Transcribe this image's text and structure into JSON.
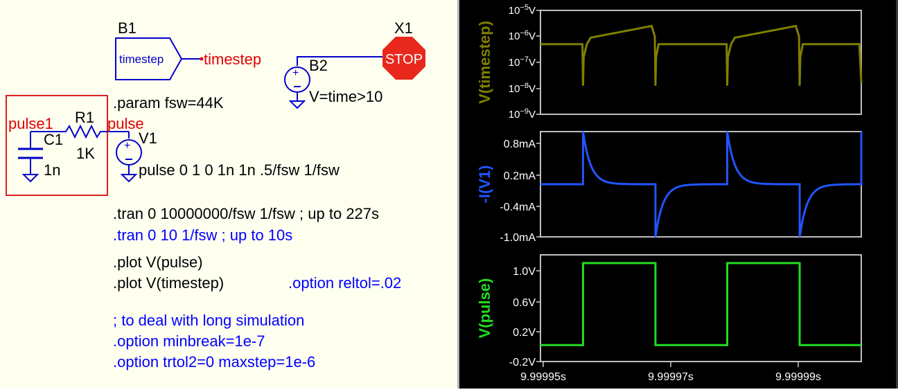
{
  "schematic": {
    "b1": {
      "label": "B1",
      "box_text": "timestep",
      "net": "timestep"
    },
    "x1": {
      "label": "X1",
      "stop": "STOP"
    },
    "b2": {
      "label": "B2",
      "expr": "V=time>10"
    },
    "param": ".param fsw=44K",
    "nets": {
      "left": "pulse1",
      "right": "pulse"
    },
    "r1": {
      "label": "R1",
      "value": "1K"
    },
    "c1": {
      "label": "C1",
      "value": "1n"
    },
    "v1": {
      "label": "V1",
      "spec": "pulse 0 1 0 1n 1n .5/fsw 1/fsw"
    },
    "directives": [
      {
        "text": ".tran 0 10000000/fsw 1/fsw ; up to 227s",
        "color": "#000000"
      },
      {
        "text": ".tran 0 10 1/fsw ; up to 10s",
        "color": "#0000ff"
      },
      {
        "text": ".plot V(pulse)",
        "color": "#000000"
      },
      {
        "text": ".plot V(timestep)",
        "color": "#000000"
      },
      {
        "text": ".option reltol=.02",
        "color": "#0000ff"
      },
      {
        "text": "; to deal with long simulation",
        "color": "#0000ff"
      },
      {
        "text": ".option minbreak=1e-7",
        "color": "#0000ff"
      },
      {
        "text": ".option trtol2=0 maxstep=1e-6",
        "color": "#0000ff"
      }
    ],
    "colors": {
      "wire": "#0000cc",
      "net_label": "#e00000",
      "selection": "#d62020",
      "stop": "#e8281c"
    }
  },
  "plots": {
    "x_ticks": [
      "9.99995s",
      "9.99997s",
      "9.99999s"
    ],
    "panes": [
      {
        "name": "V(timestep)",
        "color": "#808000",
        "log": true,
        "y_ticks": [
          {
            "base": "10",
            "exp": "−5",
            "unit": "V"
          },
          {
            "base": "10",
            "exp": "−6",
            "unit": "V"
          },
          {
            "base": "10",
            "exp": "−7",
            "unit": "V"
          },
          {
            "base": "10",
            "exp": "−8",
            "unit": "V"
          },
          {
            "base": "10",
            "exp": "−9",
            "unit": "V"
          }
        ]
      },
      {
        "name": "-I(V1)",
        "color": "#2255ff",
        "y_ticks": [
          "0.8mA",
          "0.2mA",
          "-0.4mA",
          "-1.0mA"
        ]
      },
      {
        "name": "V(pulse)",
        "color": "#22dd22",
        "y_ticks": [
          "1.0V",
          "0.6V",
          "0.2V",
          "-0.2V"
        ]
      }
    ]
  },
  "chart_data": {
    "type": "line",
    "x_unit": "s",
    "x_range": [
      9.999949,
      9.9999995
    ],
    "period": 2.27e-05,
    "rise_times": [
      9.9999557,
      9.9999784
    ],
    "fall_times": [
      9.9999671,
      9.9999898
    ],
    "series": [
      {
        "name": "V(pulse)",
        "unit": "V",
        "ylim": [
          -0.2,
          1.1
        ],
        "low": 0,
        "high": 1
      },
      {
        "name": "-I(V1)",
        "unit": "mA",
        "ylim": [
          -1.0,
          1.0
        ],
        "peak": 1.0,
        "trough": -1.0,
        "baseline": 0
      },
      {
        "name": "V(timestep)",
        "unit": "V",
        "ylim_exp": [
          -9,
          -5
        ],
        "log": true,
        "flat_exp": -6.3,
        "peak_exp": -5.6,
        "dip_exp": -7.9
      }
    ]
  }
}
